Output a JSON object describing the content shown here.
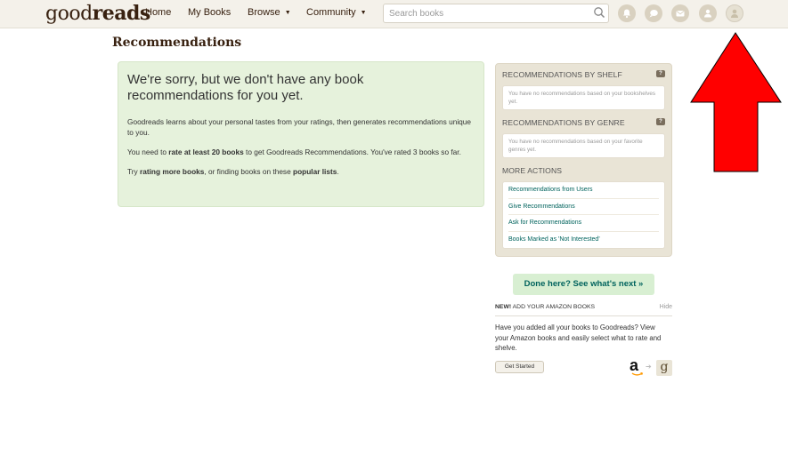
{
  "header": {
    "logo_light": "good",
    "logo_bold": "reads",
    "nav": [
      "Home",
      "My Books",
      "Browse",
      "Community"
    ],
    "search_placeholder": "Search books",
    "icons": [
      "bell-icon",
      "chat-icon",
      "mail-icon",
      "friends-icon",
      "profile-icon"
    ]
  },
  "page": {
    "title": "Recommendations"
  },
  "message": {
    "heading": "We're sorry, but we don't have any book recommendations for you yet.",
    "para1": "Goodreads learns about your personal tastes from your ratings, then generates recommendations unique to you.",
    "para2_pre": "You need to ",
    "para2_bold": "rate at least 20 books",
    "para2_post": " to get Goodreads Recommendations. You've rated 3 books so far.",
    "para3_pre": "Try ",
    "para3_link1": "rating more books",
    "para3_mid": ", or finding books on these ",
    "para3_link2": "popular lists",
    "para3_post": "."
  },
  "sidebar": {
    "shelf_head": "RECOMMENDATIONS BY SHELF",
    "shelf_text": "You have no recommendations based on your bookshelves yet.",
    "genre_head": "RECOMMENDATIONS BY GENRE",
    "genre_text": "You have no recommendations based on your favorite genres yet.",
    "help_label": "?",
    "actions_head": "MORE ACTIONS",
    "actions": [
      "Recommendations from Users",
      "Give Recommendations",
      "Ask for Recommendations",
      "Books Marked as 'Not Interested'"
    ]
  },
  "done_button": "Done here? See what's next »",
  "amazon": {
    "header_new": "NEW!",
    "header_text": " ADD YOUR AMAZON BOOKS",
    "hide": "Hide",
    "body": "Have you added all your books to Goodreads? View your Amazon books and easily select what to rate and shelve.",
    "button": "Get Started",
    "logo_a": "a",
    "logo_g": "g"
  },
  "colors": {
    "accent_green": "#00635d",
    "brand_brown": "#382110",
    "arrow_red": "#ff0000"
  }
}
